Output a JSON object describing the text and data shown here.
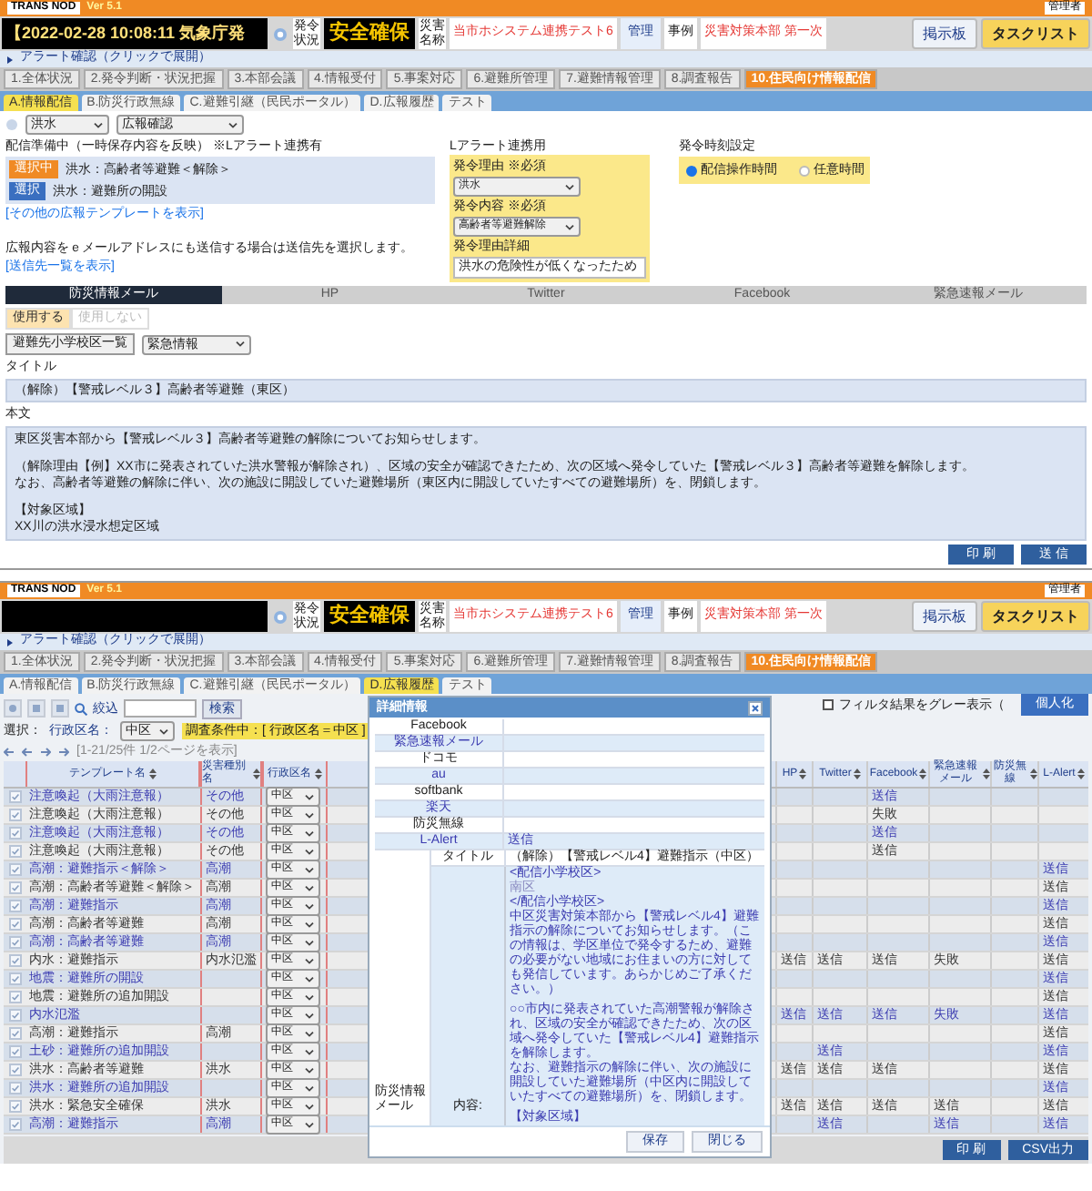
{
  "top_screen": {
    "header": {
      "app_name": "TRANS NOD",
      "version": "Ver 5.1",
      "user_role": "管理者",
      "alert_time": "【2022-02-28 10:08:11 気象庁発",
      "status_label": "発令状況",
      "status": "安全確保",
      "disaster_label": "災害名称",
      "disaster": "当市ホシステム連携テスト6",
      "admin_button": "管理",
      "case_label": "事例",
      "hq": "災害対策本部 第一次",
      "buttons": [
        "掲示板",
        "タスクリスト"
      ],
      "alert_bar": "アラート確認（クリックで展開）",
      "main_tabs": [
        {
          "label": "1.全体状況",
          "selected": false
        },
        {
          "label": "2.発令判断・状況把握",
          "selected": false
        },
        {
          "label": "3.本部会議",
          "selected": false
        },
        {
          "label": "4.情報受付",
          "selected": false
        },
        {
          "label": "5.事案対応",
          "selected": false
        },
        {
          "label": "6.避難所管理",
          "selected": false
        },
        {
          "label": "7.避難情報管理",
          "selected": false
        },
        {
          "label": "8.調査報告",
          "selected": false
        },
        {
          "label": "10.住民向け情報配信",
          "selected": true
        }
      ],
      "sub_tabs": [
        {
          "label": "A.情報配信",
          "selected": true
        },
        {
          "label": "B.防災行政無線",
          "selected": false
        },
        {
          "label": "C.避難引継（民民ポータル）",
          "selected": false
        },
        {
          "label": "D.広報履歴",
          "selected": false
        },
        {
          "label": "テスト",
          "selected": false
        }
      ]
    },
    "selects": [
      "洪水",
      "広報確認"
    ],
    "preparing": {
      "heading": "配信準備中（一時保存内容を反映） ※Lアラート連携有",
      "items": [
        {
          "button": "選択中",
          "label": "洪水：高齢者等避難＜解除＞",
          "selected": true
        },
        {
          "button": "選択",
          "label": "洪水：避難所の開設",
          "selected": false
        }
      ],
      "link": "[その他の広報テンプレートを表示]"
    },
    "lalert": {
      "heading": "Lアラート連携用",
      "reason_label": "発令理由 ※必須",
      "reason": "洪水",
      "content_label": "発令内容 ※必須",
      "content": "高齢者等避難解除",
      "detail_label": "発令理由詳細",
      "detail": "洪水の危険性が低くなったため"
    },
    "time_setting": {
      "heading": "発令時刻設定",
      "options": [
        {
          "label": "配信操作時間",
          "selected": true
        },
        {
          "label": "任意時間",
          "selected": false
        }
      ]
    },
    "email_note": "広報内容をｅメールアドレスにも送信する場合は送信先を選択します。",
    "email_link": "[送信先一覧を表示]",
    "channel_tabs": [
      {
        "label": "防災情報メール",
        "selected": true
      },
      {
        "label": "HP",
        "selected": false
      },
      {
        "label": "Twitter",
        "selected": false
      },
      {
        "label": "Facebook",
        "selected": false
      },
      {
        "label": "緊急速報メール",
        "selected": false
      }
    ],
    "use_toggle": [
      {
        "label": "使用する",
        "selected": true
      },
      {
        "label": "使用しない",
        "selected": false
      }
    ],
    "school_button": "避難先小学校区一覧",
    "category": "緊急情報",
    "title_label": "タイトル",
    "title": "（解除）【警戒レベル３】高齢者等避難（東区）",
    "body_label": "本文",
    "body": [
      [
        "東区災害本部から【警戒レベル３】高齢者等避難の解除についてお知らせします。"
      ],
      [
        "（解除理由【例】XX市に発表されていた洪水警報が解除され）、区域の安全が確認できたため、次の区域へ発令していた【警戒レベル３】高齢者等避難を解除します。",
        "なお、高齢者等避難の解除に伴い、次の施設に開設していた避難場所（東区内に開設していたすべての避難場所）を、閉鎖します。"
      ],
      [
        "【対象区域】",
        "XX川の洪水浸水想定区域"
      ]
    ],
    "footer_buttons": [
      "印 刷",
      "送 信"
    ]
  },
  "bottom_screen": {
    "header": {
      "app_name": "TRANS NOD",
      "version": "Ver 5.1",
      "user_role": "管理者",
      "status_label": "発令状況",
      "status": "安全確保",
      "disaster_label": "災害名称",
      "disaster": "当市ホシステム連携テスト6",
      "admin_button": "管理",
      "case_label": "事例",
      "hq": "災害対策本部 第一次",
      "buttons": [
        "掲示板",
        "タスクリスト"
      ],
      "alert_bar": "アラート確認（クリックで展開）",
      "main_tabs": [
        {
          "label": "1.全体状況",
          "selected": false
        },
        {
          "label": "2.発令判断・状況把握",
          "selected": false
        },
        {
          "label": "3.本部会議",
          "selected": false
        },
        {
          "label": "4.情報受付",
          "selected": false
        },
        {
          "label": "5.事案対応",
          "selected": false
        },
        {
          "label": "6.避難所管理",
          "selected": false
        },
        {
          "label": "7.避難情報管理",
          "selected": false
        },
        {
          "label": "8.調査報告",
          "selected": false
        },
        {
          "label": "10.住民向け情報配信",
          "selected": true
        }
      ],
      "sub_tabs": [
        {
          "label": "A.情報配信",
          "selected": false
        },
        {
          "label": "B.防災行政無線",
          "selected": false
        },
        {
          "label": "C.避難引継（民民ポータル）",
          "selected": false
        },
        {
          "label": "D.広報履歴",
          "selected": true
        },
        {
          "label": "テスト",
          "selected": false
        }
      ]
    },
    "filter_label": "絞込",
    "search_button": "検索",
    "gray_filter": {
      "label": "フィルタ結果をグレー表示（",
      "checked": false
    },
    "personal_button": "個人化",
    "selection_label": "選択：",
    "district_label": "行政区名：",
    "district": "中区",
    "filter_badge": "調査条件中：[ 行政区名＝中区 ]",
    "pager": "[1-21/25件 1/2ページを表示]",
    "table": {
      "columns": [
        "テンプレート名",
        "災害種別名",
        "行政区名",
        "HP",
        "Twitter",
        "Facebook",
        "緊急速報メール",
        "防災無線",
        "L-Alert"
      ],
      "rows": [
        {
          "template": "注意喚起（大雨注意報）",
          "disaster": "その他",
          "district": "中区",
          "facebook": "送信"
        },
        {
          "template": "注意喚起（大雨注意報）",
          "disaster": "その他",
          "district": "中区",
          "facebook": "失敗"
        },
        {
          "template": "注意喚起（大雨注意報）",
          "disaster": "その他",
          "district": "中区",
          "facebook": "送信"
        },
        {
          "template": "注意喚起（大雨注意報）",
          "disaster": "その他",
          "district": "中区",
          "facebook": "送信"
        },
        {
          "template": "高潮：避難指示＜解除＞",
          "disaster": "高潮",
          "district": "中区",
          "lalert": "送信"
        },
        {
          "template": "高潮：高齢者等避難＜解除＞",
          "disaster": "高潮",
          "district": "中区",
          "lalert": "送信"
        },
        {
          "template": "高潮：避難指示",
          "disaster": "高潮",
          "district": "中区",
          "lalert": "送信"
        },
        {
          "template": "高潮：高齢者等避難",
          "disaster": "高潮",
          "district": "中区",
          "lalert": "送信"
        },
        {
          "template": "高潮：高齢者等避難",
          "disaster": "高潮",
          "district": "中区",
          "lalert": "送信"
        },
        {
          "template": "内水：避難指示",
          "disaster": "内水氾濫",
          "district": "中区",
          "hp": "送信",
          "twitter": "送信",
          "facebook": "送信",
          "emergency": "失敗",
          "lalert": "送信"
        },
        {
          "template": "地震：避難所の開設",
          "district": "中区",
          "lalert": "送信"
        },
        {
          "template": "地震：避難所の追加開設",
          "district": "中区",
          "lalert": "送信"
        },
        {
          "template": "内水氾濫",
          "district": "中区",
          "hp": "送信",
          "twitter": "送信",
          "facebook": "送信",
          "emergency": "失敗",
          "lalert": "送信"
        },
        {
          "template": "高潮：避難指示",
          "disaster": "高潮",
          "district": "中区",
          "lalert": "送信"
        },
        {
          "template": "土砂：避難所の追加開設",
          "district": "中区",
          "twitter": "送信",
          "lalert": "送信"
        },
        {
          "template": "洪水：高齢者等避難",
          "disaster": "洪水",
          "district": "中区",
          "hp": "送信",
          "twitter": "送信",
          "facebook": "送信",
          "lalert": "送信"
        },
        {
          "template": "洪水：避難所の追加開設",
          "district": "中区",
          "lalert": "送信"
        },
        {
          "template": "洪水：緊急安全確保",
          "disaster": "洪水",
          "district": "中区",
          "hp": "送信",
          "twitter": "送信",
          "facebook": "送信",
          "emergency": "送信",
          "lalert": "送信"
        },
        {
          "template": "高潮：避難指示",
          "disaster": "高潮",
          "district": "中区",
          "twitter": "送信",
          "emergency": "送信",
          "lalert": "送信"
        }
      ]
    },
    "dialog": {
      "title": "詳細情報",
      "rows": [
        {
          "label": "Facebook"
        },
        {
          "label": "緊急速報メール"
        },
        {
          "label": "ドコモ"
        },
        {
          "label": "au"
        },
        {
          "label": "softbank"
        },
        {
          "label": "楽天"
        },
        {
          "label": "防災無線"
        },
        {
          "label": "L-Alert",
          "value": "送信"
        }
      ],
      "mail": {
        "label": "防災情報メール",
        "title_label": "タイトル",
        "title": "（解除）【警戒レベル4】避難指示（中区）",
        "content_label": "内容:",
        "content": [
          [
            "<配信小学校区>",
            "南区",
            "</配信小学校区>",
            "中区災害対策本部から【警戒レベル4】避難指示の解除についてお知らせします。（この情報は、学区単位で発令するため、避難の必要がない地域にお住まいの方に対しても発信しています。あらかじめご了承ください。）"
          ],
          [
            "○○市内に発表されていた高潮警報が解除され、区域の安全が確認できたため、次の区域へ発令していた【警戒レベル4】避難指示を解除します。",
            "なお、避難指示の解除に伴い、次の施設に開設していた避難場所（中区内に開設していたすべての避難場所）を、閉鎖します。"
          ],
          [
            "【対象区域】"
          ]
        ]
      },
      "buttons": [
        "保存",
        "閉じる"
      ]
    },
    "footer_buttons": [
      "印 刷",
      "CSV出力"
    ]
  }
}
